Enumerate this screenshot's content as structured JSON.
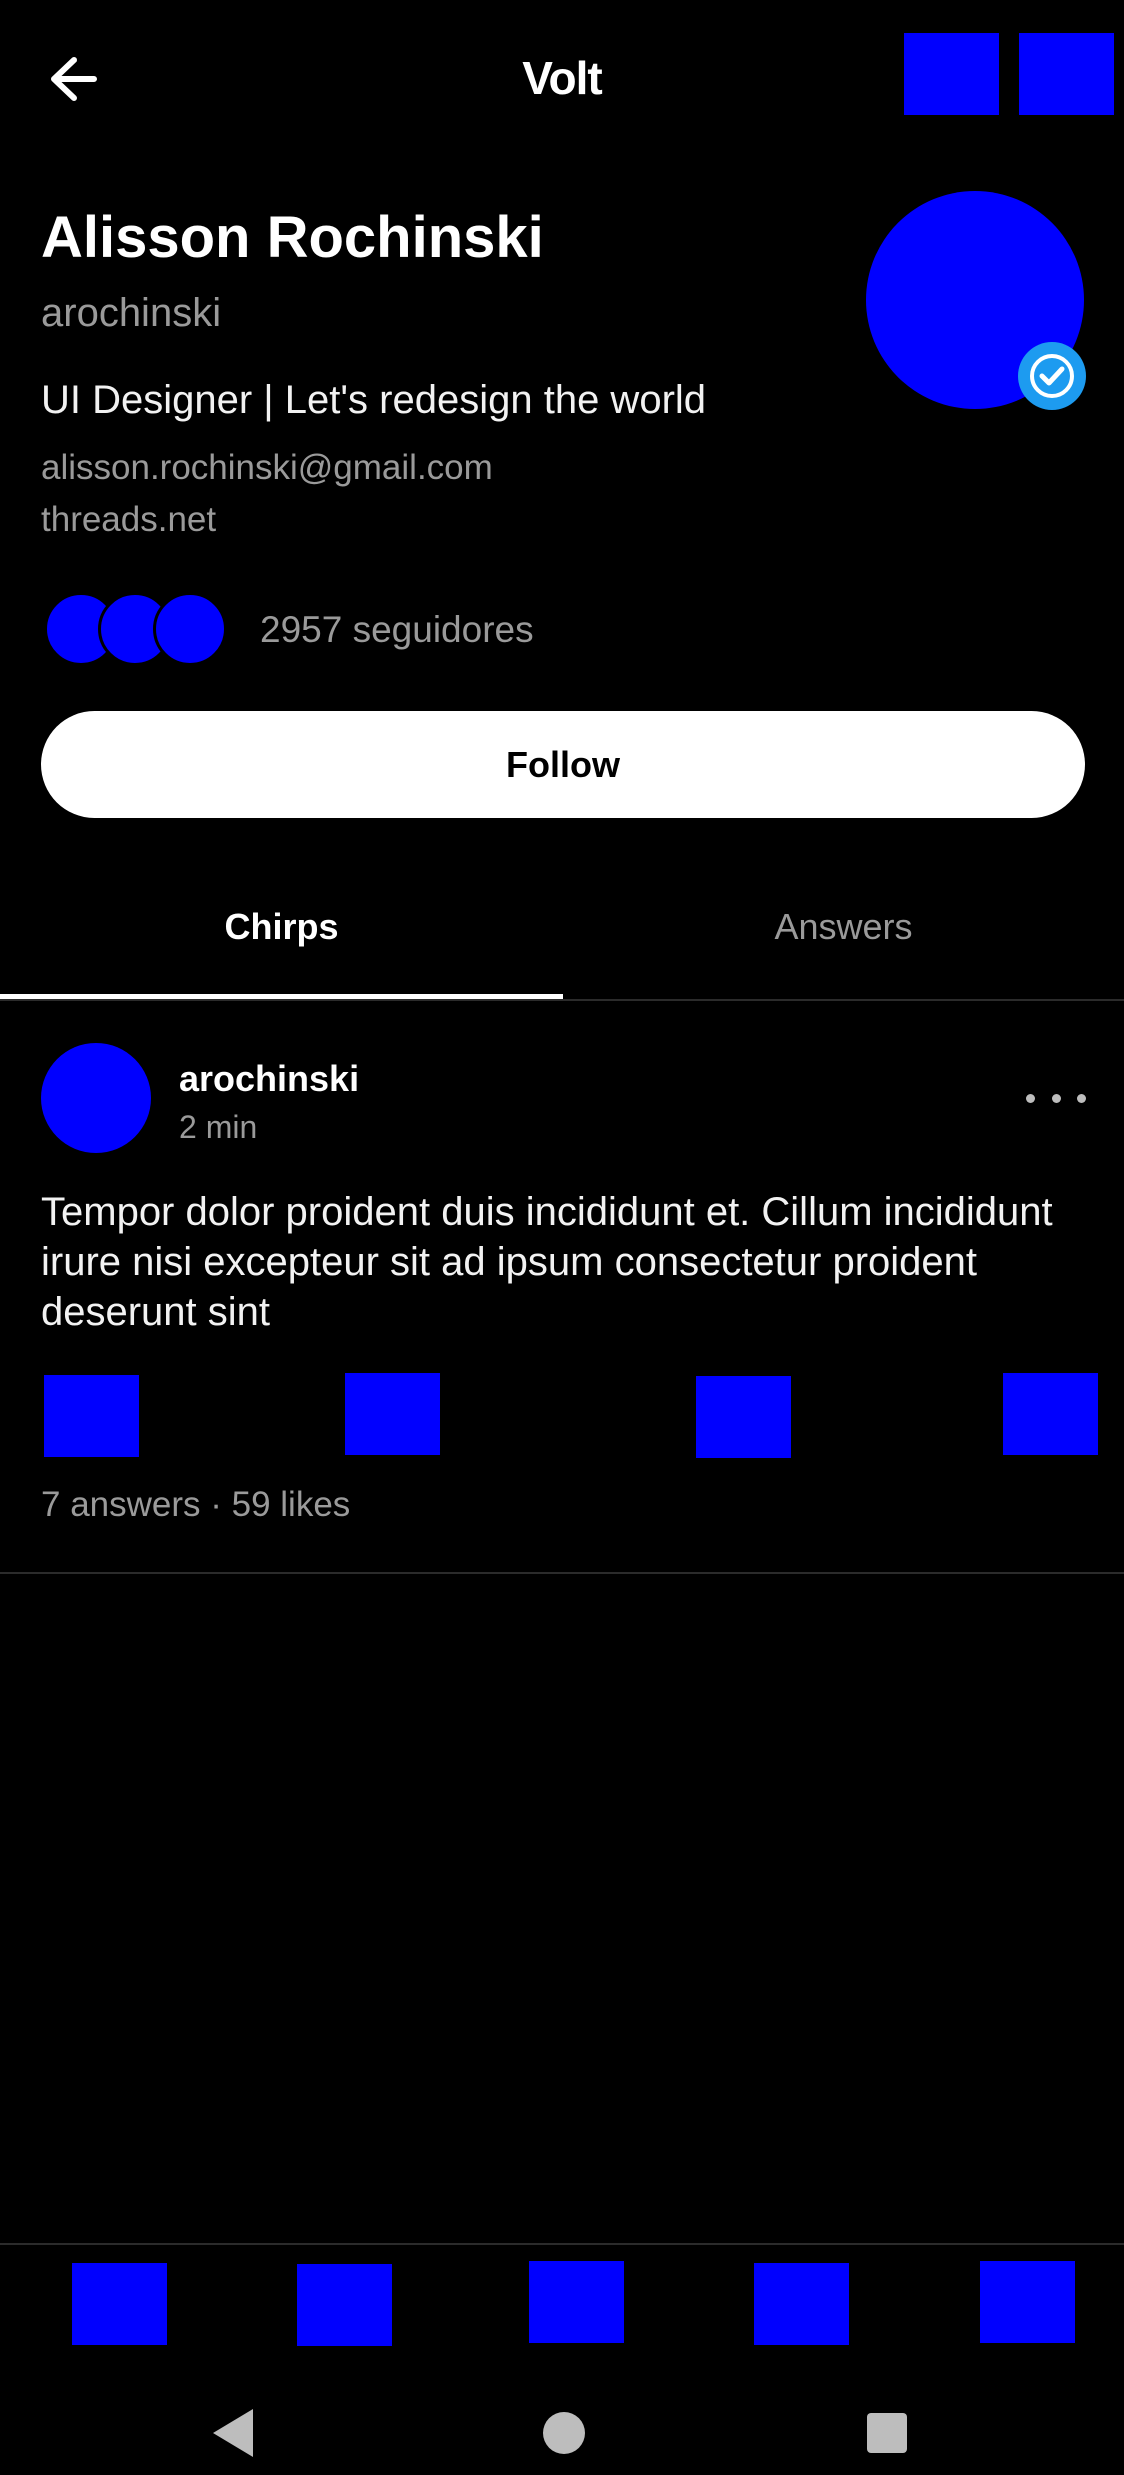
{
  "colors": {
    "background": "#000000",
    "placeholder": "#0000ff",
    "verified": "#1d9bf0",
    "muted_text": "#9a9a9a"
  },
  "header": {
    "back_icon": "arrow-left-icon",
    "title": "Volt",
    "actions": [
      "placeholder-icon",
      "placeholder-icon"
    ]
  },
  "profile": {
    "name": "Alisson Rochinski",
    "handle": "arochinski",
    "bio": "UI Designer | Let's redesign the world",
    "email": "alisson.rochinski@gmail.com",
    "website": "threads.net",
    "verified_icon": "check-badge-icon",
    "followers_text": "2957 seguidores",
    "follow_button": "Follow"
  },
  "tabs": [
    {
      "label": "Chirps",
      "active": true
    },
    {
      "label": "Answers",
      "active": false
    }
  ],
  "post": {
    "username": "arochinski",
    "time": "2 min",
    "more_icon": "more-horizontal-icon",
    "text": "Tempor dolor proident duis incididunt et. Cillum incididunt irure nisi excepteur sit ad ipsum consectetur proident deserunt sint",
    "stats": "7 answers · 59 likes"
  },
  "bottom_nav": {
    "item_count": 5
  },
  "system_nav": {
    "icons": [
      "triangle-back-icon",
      "circle-home-icon",
      "square-recents-icon"
    ]
  }
}
